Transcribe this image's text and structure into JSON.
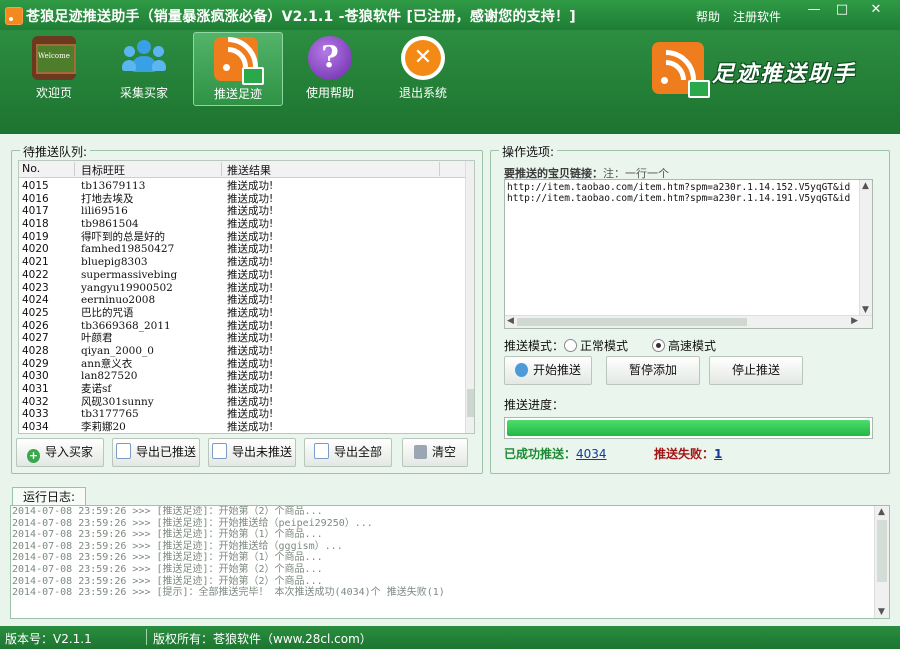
{
  "window": {
    "title": "苍狼足迹推送助手（销量暴涨疯涨必备）V2.1.1 -苍狼软件 [已注册，感谢您的支持！]",
    "help_link": "帮助",
    "register_link": "注册软件",
    "min": "—",
    "max": "□",
    "close": "✕"
  },
  "toolbar": {
    "items": [
      {
        "label": "欢迎页",
        "icon": "welcome-board-icon"
      },
      {
        "label": "采集买家",
        "icon": "people-icon"
      },
      {
        "label": "推送足迹",
        "icon": "rss-push-icon",
        "active": true
      },
      {
        "label": "使用帮助",
        "icon": "question-icon"
      },
      {
        "label": "退出系统",
        "icon": "exit-icon"
      }
    ],
    "brand": "足迹推送助手"
  },
  "queue": {
    "title": "待推送队列:",
    "headers": {
      "no": "No.",
      "name": "目标旺旺",
      "result": "推送结果"
    },
    "rows": [
      {
        "no": "4015",
        "name": "tb13679113",
        "result": "推送成功!"
      },
      {
        "no": "4016",
        "name": "打地去埃及",
        "result": "推送成功!"
      },
      {
        "no": "4017",
        "name": "lili69516",
        "result": "推送成功!"
      },
      {
        "no": "4018",
        "name": "tb9861504",
        "result": "推送成功!"
      },
      {
        "no": "4019",
        "name": "得吓到的总是好的",
        "result": "推送成功!"
      },
      {
        "no": "4020",
        "name": "famhed19850427",
        "result": "推送成功!"
      },
      {
        "no": "4021",
        "name": "bluepig8303",
        "result": "推送成功!"
      },
      {
        "no": "4022",
        "name": "supermassivebing",
        "result": "推送成功!"
      },
      {
        "no": "4023",
        "name": "yangyu19900502",
        "result": "推送成功!"
      },
      {
        "no": "4024",
        "name": "eerninuo2008",
        "result": "推送成功!"
      },
      {
        "no": "4025",
        "name": "巴比的咒语",
        "result": "推送成功!"
      },
      {
        "no": "4026",
        "name": "tb3669368_2011",
        "result": "推送成功!"
      },
      {
        "no": "4027",
        "name": "叶颜君",
        "result": "推送成功!"
      },
      {
        "no": "4028",
        "name": "qiyan_2000_0",
        "result": "推送成功!"
      },
      {
        "no": "4029",
        "name": "ann意义衣",
        "result": "推送成功!"
      },
      {
        "no": "4030",
        "name": "lan827520",
        "result": "推送成功!"
      },
      {
        "no": "4031",
        "name": "麦诺sf",
        "result": "推送成功!"
      },
      {
        "no": "4032",
        "name": "风砚301sunny",
        "result": "推送成功!"
      },
      {
        "no": "4033",
        "name": "tb3177765",
        "result": "推送成功!"
      },
      {
        "no": "4034",
        "name": "李莉娜20",
        "result": "推送成功!"
      }
    ],
    "buttons": {
      "import": "导入买家",
      "export_pushed": "导出已推送",
      "export_unpushed": "导出未推送",
      "export_all": "导出全部",
      "clear": "清空"
    }
  },
  "options": {
    "title": "操作选项:",
    "urls_label": "要推送的宝贝链接：",
    "urls_hint": "注：一行一个",
    "urls": [
      "http://item.taobao.com/item.htm?spm=a230r.1.14.152.V5yqGT&id",
      "http://item.taobao.com/item.htm?spm=a230r.1.14.191.V5yqGT&id"
    ],
    "mode_label": "推送模式：",
    "mode_normal": "正常模式",
    "mode_fast": "高速模式",
    "selected_mode": "fast",
    "btn_start": "开始推送",
    "btn_pause": "暂停添加",
    "btn_stop": "停止推送",
    "progress_label": "推送进度：",
    "progress_fraction": 1.0,
    "success_label": "已成功推送：",
    "success_count": "4034",
    "fail_label": "推送失败：",
    "fail_count": "1"
  },
  "log": {
    "tab": "运行日志:",
    "lines": [
      "2014-07-08 23:59:26 >>> [推送足迹]：开始第（2）个商品...",
      "2014-07-08 23:59:26 >>> [推送足迹]：开始推送给（peipei29250）...",
      "2014-07-08 23:59:26 >>> [推送足迹]：开始第（1）个商品...",
      "2014-07-08 23:59:26 >>> [推送足迹]：开始推送给（gggism）...",
      "2014-07-08 23:59:26 >>> [推送足迹]：开始第（1）个商品...",
      "2014-07-08 23:59:26 >>> [推送足迹]：开始第（2）个商品...",
      "2014-07-08 23:59:26 >>> [推送足迹]：开始第（2）个商品...",
      "2014-07-08 23:59:26 >>> [提示]：全部推送完毕！ 本次推送成功(4034)个 推送失败(1)"
    ]
  },
  "statusbar": {
    "version": "版本号：V2.1.1",
    "copyright": "版权所有：苍狼软件（www.28cl.com）"
  }
}
